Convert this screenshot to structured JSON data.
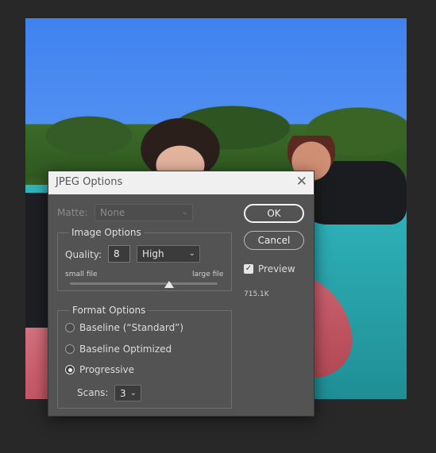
{
  "dialog": {
    "title": "JPEG Options",
    "close_glyph": "✕"
  },
  "matte": {
    "label": "Matte:",
    "value": "None",
    "enabled": false
  },
  "image_options": {
    "legend": "Image Options",
    "quality_label": "Quality:",
    "quality_value": "8",
    "quality_preset": "High",
    "slider_min_label": "small file",
    "slider_max_label": "large file",
    "slider_value_fraction": 0.67
  },
  "format_options": {
    "legend": "Format Options",
    "options": [
      {
        "label": "Baseline (“Standard”)",
        "selected": false
      },
      {
        "label": "Baseline Optimized",
        "selected": false
      },
      {
        "label": "Progressive",
        "selected": true
      }
    ],
    "scans_label": "Scans:",
    "scans_value": "3"
  },
  "buttons": {
    "ok": "OK",
    "cancel": "Cancel"
  },
  "preview": {
    "label": "Preview",
    "checked": true,
    "check_glyph": "✓",
    "file_size": "715.1K"
  },
  "icons": {
    "chevron": "⌄"
  }
}
